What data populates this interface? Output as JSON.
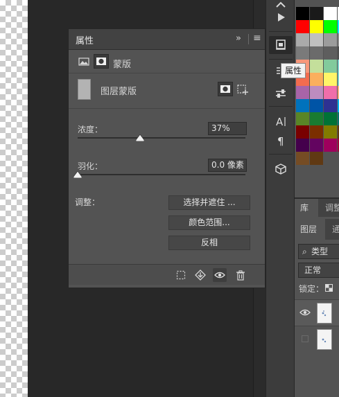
{
  "properties_panel": {
    "title": "属性",
    "mask_tab_label": "蒙版",
    "mask_type_label": "图层蒙版",
    "density_label": "浓度：",
    "density_value": "37%",
    "density_fraction": 0.37,
    "feather_label": "羽化：",
    "feather_value": "0.0 像素",
    "feather_fraction": 0.0,
    "refine_label": "调整：",
    "buttons": {
      "select_and_mask": "选择并遮住 ...",
      "color_range": "颜色范围...",
      "invert": "反相"
    },
    "collapse_glyph": "»",
    "menu_glyph": "≡"
  },
  "tooltip": {
    "text": "属性"
  },
  "strip_icons": [
    "history-icon",
    "play-icon",
    "properties-icon",
    "adjustments-icon",
    "sliders-icon",
    "character-icon",
    "paragraph-icon",
    "3d-cube-icon"
  ],
  "swatch_colors": [
    [
      "#000000",
      "#1a1a1a",
      "#ffffff",
      "#ffffff"
    ],
    [
      "#ff0000",
      "#ffff00",
      "#00ff00",
      "#00ffff"
    ],
    [
      "#aaaaaa",
      "#c0c0c0",
      "#9c9c9c",
      "#8a8a8a"
    ],
    [
      "#7a7a7a",
      "#6b6b6b",
      "#5e5e5e",
      "#4f4f4f"
    ],
    [
      "#f7977a",
      "#c4df9b",
      "#82ca9c",
      "#7bcdc8"
    ],
    [
      "#f26c4f",
      "#fbaf5d",
      "#fff568",
      "#7accc8"
    ],
    [
      "#a864a8",
      "#bd8cbf",
      "#f06eaa",
      "#f9ad81"
    ],
    [
      "#0072bc",
      "#0054a6",
      "#2e3192",
      "#00aeef"
    ],
    [
      "#598527",
      "#197b30",
      "#007236",
      "#00746b"
    ],
    [
      "#790000",
      "#7b2e00",
      "#827b00",
      "#603913"
    ],
    [
      "#44004c",
      "#630460",
      "#9e005d",
      "#9e0039"
    ],
    [
      "#754c24",
      "#603913",
      "#535353",
      "#535353"
    ]
  ],
  "library_tabs": [
    "库",
    "调整"
  ],
  "layers": {
    "tabs": [
      "图层",
      "通道"
    ],
    "filter_label": "类型",
    "blend_mode": "正常",
    "lock_label": "锁定："
  }
}
